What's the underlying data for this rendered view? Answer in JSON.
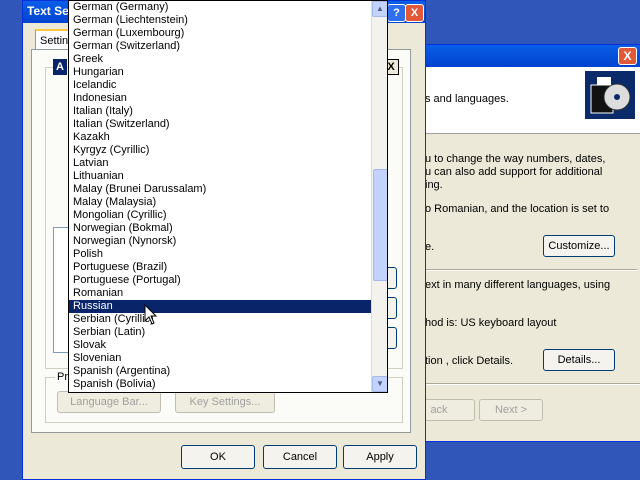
{
  "back_dialog": {
    "banner_text": "s and languages.",
    "desc_lines": [
      "u to change the way numbers, dates,",
      "u can also add support for additional",
      "ing."
    ],
    "location_line": "o Romanian, and the location is set to",
    "location_line2": "e.",
    "customize_label": "Customize...",
    "input_lines": [
      "ext in many different languages, using"
    ],
    "method_line": "hod is: US keyboard layout",
    "details_line": "tion , click Details.",
    "details_label": "Details...",
    "back_label": "ack",
    "next_label": "Next >",
    "close_glyph": "X"
  },
  "ts_dialog": {
    "title": "Text Se",
    "tab_label": "Settin",
    "help_glyph": "?",
    "close_glyph": "X",
    "inner_title_fragment": "A",
    "inner_close_glyph": "X",
    "pref_label": "Pre",
    "language_bar_label": "Language Bar...",
    "key_settings_label": "Key Settings...",
    "ok_label": "OK",
    "cancel_label": "Cancel",
    "apply_label": "Apply"
  },
  "language_list": {
    "selected": "Russian",
    "items": [
      "German (Germany)",
      "German (Liechtenstein)",
      "German (Luxembourg)",
      "German (Switzerland)",
      "Greek",
      "Hungarian",
      "Icelandic",
      "Indonesian",
      "Italian (Italy)",
      "Italian (Switzerland)",
      "Kazakh",
      "Kyrgyz (Cyrillic)",
      "Latvian",
      "Lithuanian",
      "Malay (Brunei Darussalam)",
      "Malay (Malaysia)",
      "Mongolian (Cyrillic)",
      "Norwegian (Bokmal)",
      "Norwegian (Nynorsk)",
      "Polish",
      "Portuguese (Brazil)",
      "Portuguese (Portugal)",
      "Romanian",
      "Russian",
      "Serbian (Cyrillic)",
      "Serbian (Latin)",
      "Slovak",
      "Slovenian",
      "Spanish (Argentina)",
      "Spanish (Bolivia)"
    ],
    "scroll_up_glyph": "▲",
    "scroll_down_glyph": "▼"
  }
}
